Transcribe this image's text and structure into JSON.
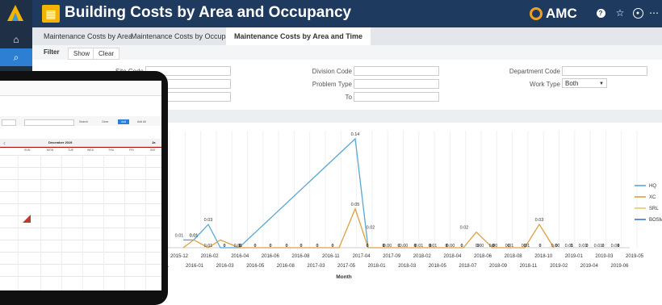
{
  "app": {
    "title": "Building Costs by Area and Occupancy",
    "brand": "AMC",
    "brand_color": "#f0a020",
    "accent": "#f2b400"
  },
  "header_icons": [
    "help-icon",
    "favorite-icon",
    "user-icon",
    "more-icon"
  ],
  "leftnav": {
    "items": [
      "home-icon",
      "search-icon",
      "settings-icon"
    ]
  },
  "tabs": [
    {
      "label": "Maintenance Costs by Area",
      "active": false
    },
    {
      "label": "Maintenance Costs by Occupancy",
      "active": false
    },
    {
      "label": "Maintenance Costs by Area and Time",
      "active": true
    }
  ],
  "filterbar": {
    "label": "Filter",
    "show": "Show",
    "clear": "Clear"
  },
  "form": {
    "site_code": {
      "label": "Site Code",
      "value": ""
    },
    "division_code": {
      "label": "Division Code",
      "value": ""
    },
    "department_code": {
      "label": "Department Code",
      "value": ""
    },
    "problem_type": {
      "label": "Problem Type",
      "value": ""
    },
    "work_type": {
      "label": "Work Type",
      "value": "Both"
    },
    "to": {
      "label": "To",
      "value": ""
    }
  },
  "tablet": {
    "month_label": "December 2019",
    "next_month": "Ja",
    "days": [
      "SUN",
      "MON",
      "TUE",
      "WED",
      "THU",
      "FRI",
      "SAT"
    ],
    "toolbar": [
      "Search",
      "Clear",
      "Add",
      "Add All"
    ]
  },
  "chart_data": {
    "type": "line",
    "xlabel": "Month",
    "x_top": [
      "2015-12",
      "2016-02",
      "2016-04",
      "2016-06",
      "2016-08",
      "2016-11",
      "2017-04",
      "2017-09",
      "2018-02",
      "2018-04",
      "2018-06",
      "2018-08",
      "2018-10",
      "2019-01",
      "2019-03",
      "2019-05"
    ],
    "x_bottom": [
      "2016-01",
      "2016-03",
      "2016-05",
      "2016-08",
      "2017-03",
      "2017-05",
      "2018-01",
      "2018-03",
      "2018-05",
      "2018-07",
      "2018-09",
      "2018-11",
      "2019-02",
      "2019-04",
      "2019-06"
    ],
    "x_bottom_partial": "11",
    "legend": [
      {
        "name": "HQ",
        "color": "#5aa7d6"
      },
      {
        "name": "XC",
        "color": "#e0a040"
      },
      {
        "name": "SRL",
        "color": "#e8c870"
      },
      {
        "name": "BOSM",
        "color": "#3a78c8"
      }
    ],
    "series": [
      {
        "name": "HQ",
        "color": "#5aa7d6",
        "points": [
          [
            227,
            0.01
          ],
          [
            240,
            0.01
          ],
          [
            258,
            0.03
          ],
          [
            273,
            0.0
          ],
          [
            296,
            0.0
          ],
          [
            440,
            0.14
          ],
          [
            456,
            0.0
          ]
        ]
      },
      {
        "name": "XC",
        "color": "#e0a040",
        "points": [
          [
            227,
            0.0
          ],
          [
            240,
            0.01
          ],
          [
            258,
            0.0
          ],
          [
            273,
            0.01
          ],
          [
            296,
            0.0
          ],
          [
            420,
            0.0
          ],
          [
            440,
            0.05
          ],
          [
            456,
            0.0
          ],
          [
            574,
            0.0
          ],
          [
            590,
            0.02
          ],
          [
            610,
            0.0
          ],
          [
            650,
            0.0
          ],
          [
            668,
            0.03
          ],
          [
            686,
            0.0
          ]
        ]
      },
      {
        "name": "SRL",
        "color": "#e8c870",
        "points": []
      },
      {
        "name": "BOSM",
        "color": "#3a78c8",
        "points": []
      }
    ],
    "data_labels": [
      {
        "v": "0.14",
        "x": 440,
        "y": 0.14
      },
      {
        "v": "0.05",
        "x": 440,
        "y": 0.05
      },
      {
        "v": "0.03",
        "x": 258,
        "y": 0.03
      },
      {
        "v": "0.01",
        "x": 222,
        "y": 0.01
      },
      {
        "v": "0.01",
        "x": 240,
        "y": 0.01
      },
      {
        "v": "0.01",
        "x": 240,
        "y": 0.01
      },
      {
        "v": "0.01",
        "x": 258,
        "y": 0.0
      },
      {
        "v": "0.02",
        "x": 459,
        "y": 0.02
      },
      {
        "v": "0.02",
        "x": 575,
        "y": 0.02
      },
      {
        "v": "0.03",
        "x": 668,
        "y": 0.03
      },
      {
        "v": "0.01",
        "x": 295,
        "y": 0.0
      },
      {
        "v": "0.01",
        "x": 519,
        "y": 0.0
      },
      {
        "v": "0.01",
        "x": 536,
        "y": 0.0
      },
      {
        "v": "0.01",
        "x": 631,
        "y": 0.0
      },
      {
        "v": "0.01",
        "x": 651,
        "y": 0.0
      },
      {
        "v": "0.01",
        "x": 705,
        "y": 0.0
      },
      {
        "v": "0.01",
        "x": 722,
        "y": 0.0
      },
      {
        "v": "0.01",
        "x": 741,
        "y": 0.0
      },
      {
        "v": "0.01",
        "x": 762,
        "y": 0.0
      },
      {
        "v": "0.00",
        "x": 480,
        "y": 0.0
      },
      {
        "v": "0.00",
        "x": 500,
        "y": 0.0
      },
      {
        "v": "0.00",
        "x": 558,
        "y": 0.0
      },
      {
        "v": "0.00",
        "x": 594,
        "y": 0.0
      },
      {
        "v": "0.00",
        "x": 611,
        "y": 0.0
      },
      {
        "v": "0.00",
        "x": 688,
        "y": 0.0
      },
      {
        "v": "0",
        "x": 316,
        "y": 0
      },
      {
        "v": "0",
        "x": 335,
        "y": 0
      },
      {
        "v": "0",
        "x": 355,
        "y": 0
      },
      {
        "v": "0",
        "x": 373,
        "y": 0
      },
      {
        "v": "0",
        "x": 393,
        "y": 0
      },
      {
        "v": "0",
        "x": 412,
        "y": 0
      },
      {
        "v": "0",
        "x": 455,
        "y": 0
      },
      {
        "v": "0",
        "x": 475,
        "y": 0
      },
      {
        "v": "0",
        "x": 494,
        "y": 0
      },
      {
        "v": "0",
        "x": 514,
        "y": 0
      },
      {
        "v": "0",
        "x": 533,
        "y": 0
      },
      {
        "v": "0",
        "x": 553,
        "y": 0
      },
      {
        "v": "0",
        "x": 572,
        "y": 0
      },
      {
        "v": "0",
        "x": 592,
        "y": 0
      },
      {
        "v": "0",
        "x": 611,
        "y": 0
      },
      {
        "v": "0",
        "x": 630,
        "y": 0
      },
      {
        "v": "0",
        "x": 650,
        "y": 0
      },
      {
        "v": "0",
        "x": 669,
        "y": 0
      },
      {
        "v": "0",
        "x": 689,
        "y": 0
      },
      {
        "v": "0",
        "x": 708,
        "y": 0
      },
      {
        "v": "0",
        "x": 727,
        "y": 0
      },
      {
        "v": "0",
        "x": 747,
        "y": 0
      },
      {
        "v": "0",
        "x": 766,
        "y": 0
      },
      {
        "v": "0",
        "x": 278,
        "y": 0
      },
      {
        "v": "0",
        "x": 297,
        "y": 0
      }
    ],
    "ylim": [
      0,
      0.14
    ]
  }
}
